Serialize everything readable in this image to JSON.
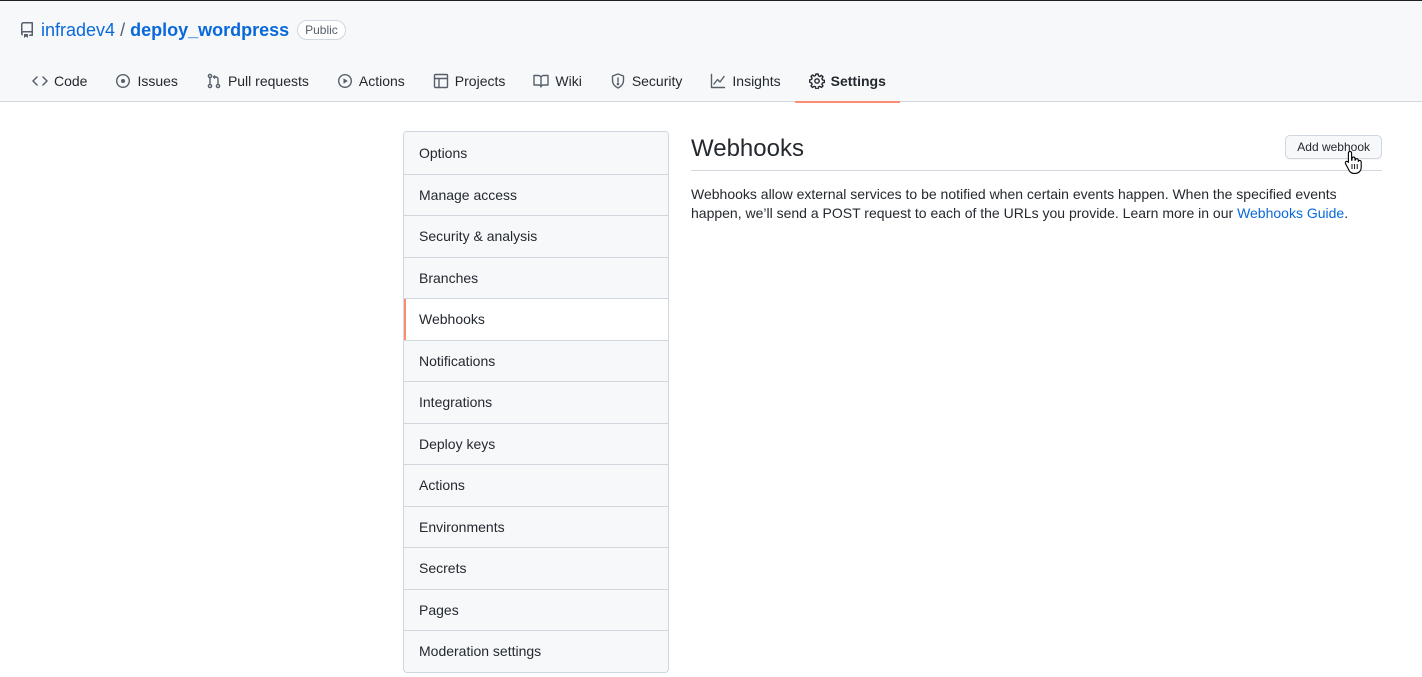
{
  "repo": {
    "owner": "infradev4",
    "separator": "/",
    "name": "deploy_wordpress",
    "visibility": "Public",
    "icon": "repo-icon"
  },
  "tabs": [
    {
      "label": "Code",
      "icon": "code-icon",
      "selected": false
    },
    {
      "label": "Issues",
      "icon": "issue-opened-icon",
      "selected": false
    },
    {
      "label": "Pull requests",
      "icon": "git-pull-request-icon",
      "selected": false
    },
    {
      "label": "Actions",
      "icon": "play-icon",
      "selected": false
    },
    {
      "label": "Projects",
      "icon": "table-icon",
      "selected": false
    },
    {
      "label": "Wiki",
      "icon": "book-icon",
      "selected": false
    },
    {
      "label": "Security",
      "icon": "shield-icon",
      "selected": false
    },
    {
      "label": "Insights",
      "icon": "graph-icon",
      "selected": false
    },
    {
      "label": "Settings",
      "icon": "gear-icon",
      "selected": true
    }
  ],
  "settings_menu": {
    "items": [
      {
        "label": "Options"
      },
      {
        "label": "Manage access"
      },
      {
        "label": "Security & analysis"
      },
      {
        "label": "Branches"
      },
      {
        "label": "Webhooks"
      },
      {
        "label": "Notifications"
      },
      {
        "label": "Integrations"
      },
      {
        "label": "Deploy keys"
      },
      {
        "label": "Actions"
      },
      {
        "label": "Environments"
      },
      {
        "label": "Secrets"
      },
      {
        "label": "Pages"
      },
      {
        "label": "Moderation settings"
      }
    ],
    "selected_index": 4
  },
  "main": {
    "title": "Webhooks",
    "add_button_label": "Add webhook",
    "description_text": "Webhooks allow external services to be notified when certain events happen. When the specified events happen, we’ll send a POST request to each of the URLs you provide. Learn more in our ",
    "guide_link_label": "Webhooks Guide",
    "description_end": "."
  },
  "colors": {
    "link": "#0969da",
    "tab_underline": "#fd8c73",
    "border": "#d0d7de",
    "header_bg": "#f6f8fa"
  }
}
